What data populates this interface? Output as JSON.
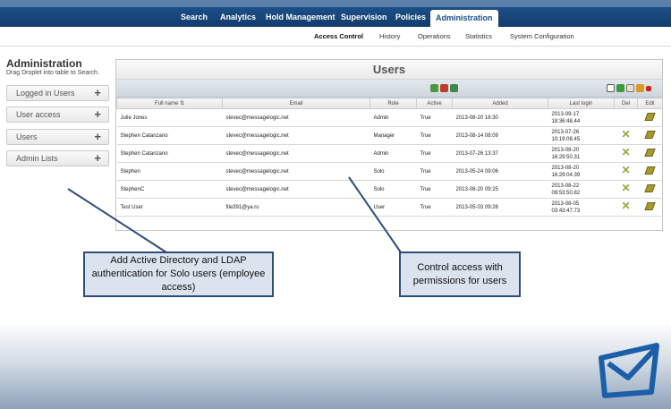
{
  "nav": {
    "items": [
      "Search",
      "Analytics",
      "Hold Management",
      "Supervision",
      "Policies",
      "Administration"
    ],
    "active": "Administration"
  },
  "subnav": {
    "items": [
      "Access Control",
      "History",
      "Operations",
      "Statistics",
      "System Configuration"
    ],
    "active": "Access Control"
  },
  "sidebar": {
    "title": "Administration",
    "subtitle": "Drag Droplet into table to Search.",
    "items": [
      "Logged in Users",
      "User access",
      "Users",
      "Admin Lists"
    ],
    "plus": "+"
  },
  "panel": {
    "title": "Users",
    "columns": [
      "Full name ⇅",
      "Email",
      "Role",
      "Active",
      "Added",
      "Last login",
      "Del",
      "Edit"
    ],
    "rows": [
      {
        "name": "Julie Jones",
        "email": "stevec@messagelogic.net",
        "role": "Admin",
        "active": "True",
        "added": "2013-08-20 16:30",
        "login1": "2013-09-17",
        "login2": "18:36:48.44"
      },
      {
        "name": "Stephen Catanzano",
        "email": "stevec@messagelogic.net",
        "role": "Manager",
        "active": "True",
        "added": "2013-08-14 08:09",
        "login1": "2013-07-26",
        "login2": "10:19:08.45"
      },
      {
        "name": "Stephen Catanzano",
        "email": "stevec@messagelogic.net",
        "role": "Admin",
        "active": "True",
        "added": "2013-07-26 13:37",
        "login1": "2013-08-20",
        "login2": "16:29:50.31"
      },
      {
        "name": "Stephen",
        "email": "stevec@messagelogic.net",
        "role": "Solo",
        "active": "True",
        "added": "2013-05-24 09:06",
        "login1": "2013-08-20",
        "login2": "16:29:04.39"
      },
      {
        "name": "StephenC",
        "email": "stevec@messagelogic.net",
        "role": "Solo",
        "active": "True",
        "added": "2013-08-20 09:25",
        "login1": "2013-08-22",
        "login2": "09:53:50.82"
      },
      {
        "name": "Test User",
        "email": "file391@ya.ru",
        "role": "User",
        "active": "True",
        "added": "2013-05-03 09:26",
        "login1": "2013-08-05",
        "login2": "03:43:47.73"
      }
    ]
  },
  "callouts": {
    "left": "Add Active Directory and LDAP authentication for Solo users (employee access)",
    "right": "Control access with permissions for users"
  },
  "colors": {
    "nav": "#1c4f86",
    "callout_border": "#2f4f78",
    "callout_fill": "#dbe3ee",
    "logo": "#1c5ea8"
  }
}
